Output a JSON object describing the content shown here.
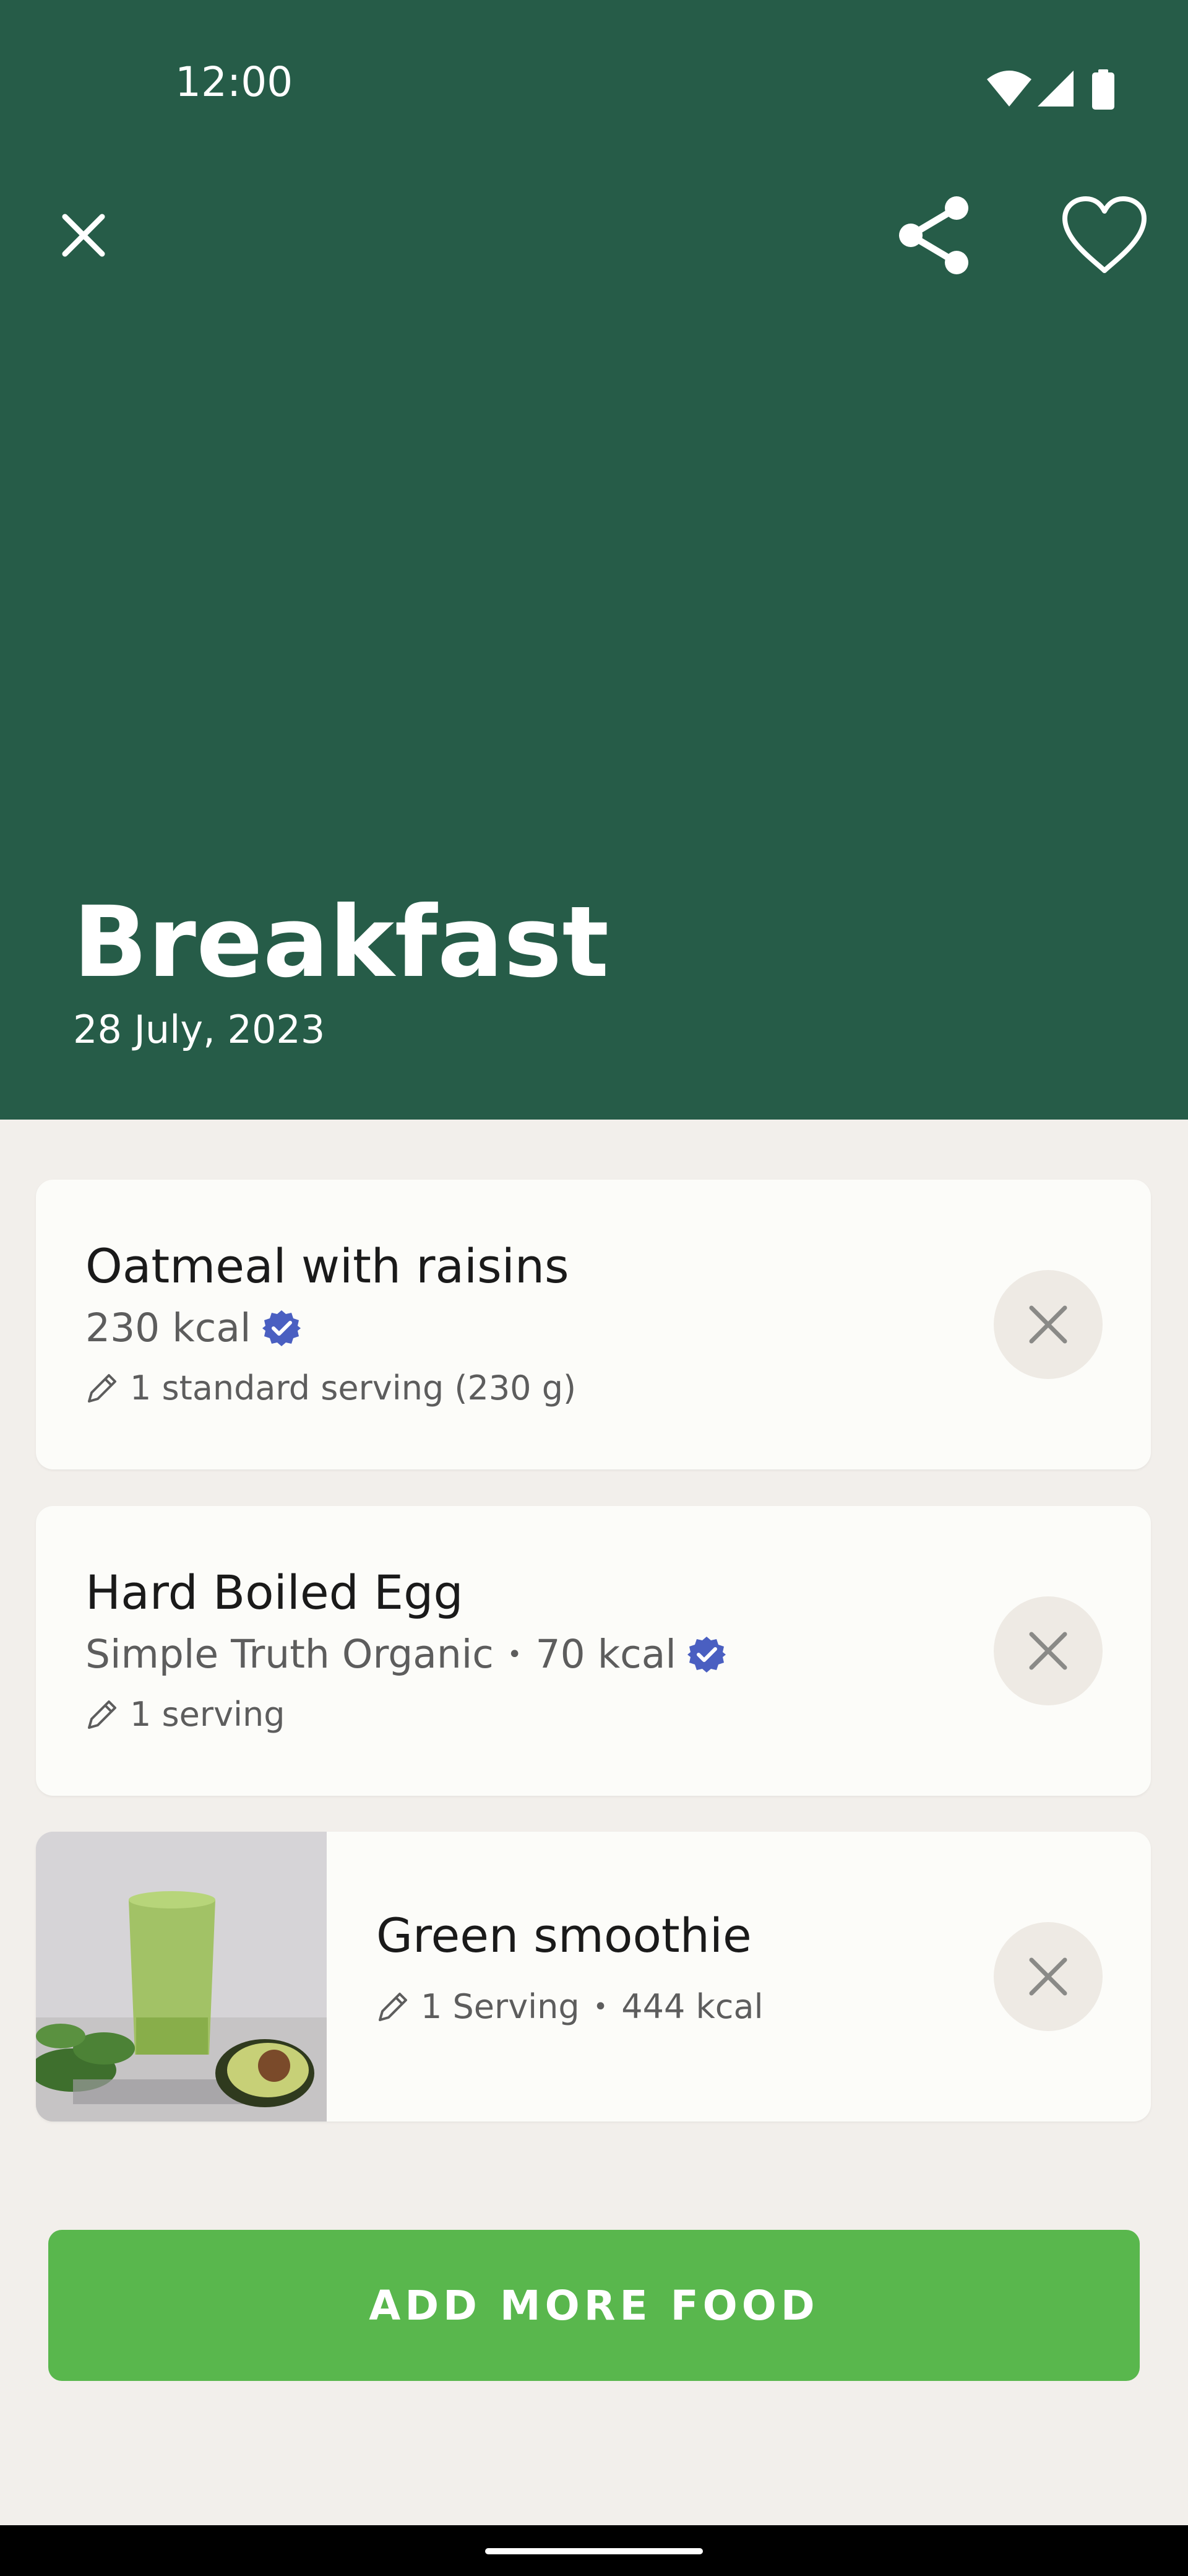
{
  "status_bar": {
    "time": "12:00"
  },
  "header": {
    "title": "Breakfast",
    "date": "28 July, 2023",
    "background_color": "#265C48",
    "close_icon": "close-icon",
    "share_icon": "share-icon",
    "favorite_icon": "heart-outline-icon"
  },
  "foods": [
    {
      "name": "Oatmeal with raisins",
      "kcal": "230 kcal",
      "verified": true,
      "portion": "1 standard serving (230 g)"
    },
    {
      "name": "Hard Boiled Egg",
      "brand": "Simple Truth Organic",
      "kcal": "70 kcal",
      "verified": true,
      "portion": "1 serving"
    },
    {
      "name": "Green smoothie",
      "portion": "1 Serving",
      "kcal": "444 kcal",
      "has_image": true
    }
  ],
  "actions": {
    "add_more_label": "ADD MORE FOOD",
    "accent_color": "#59B74D"
  },
  "colors": {
    "verified_badge": "#4A5FC1",
    "background": "#F2EFEB"
  }
}
